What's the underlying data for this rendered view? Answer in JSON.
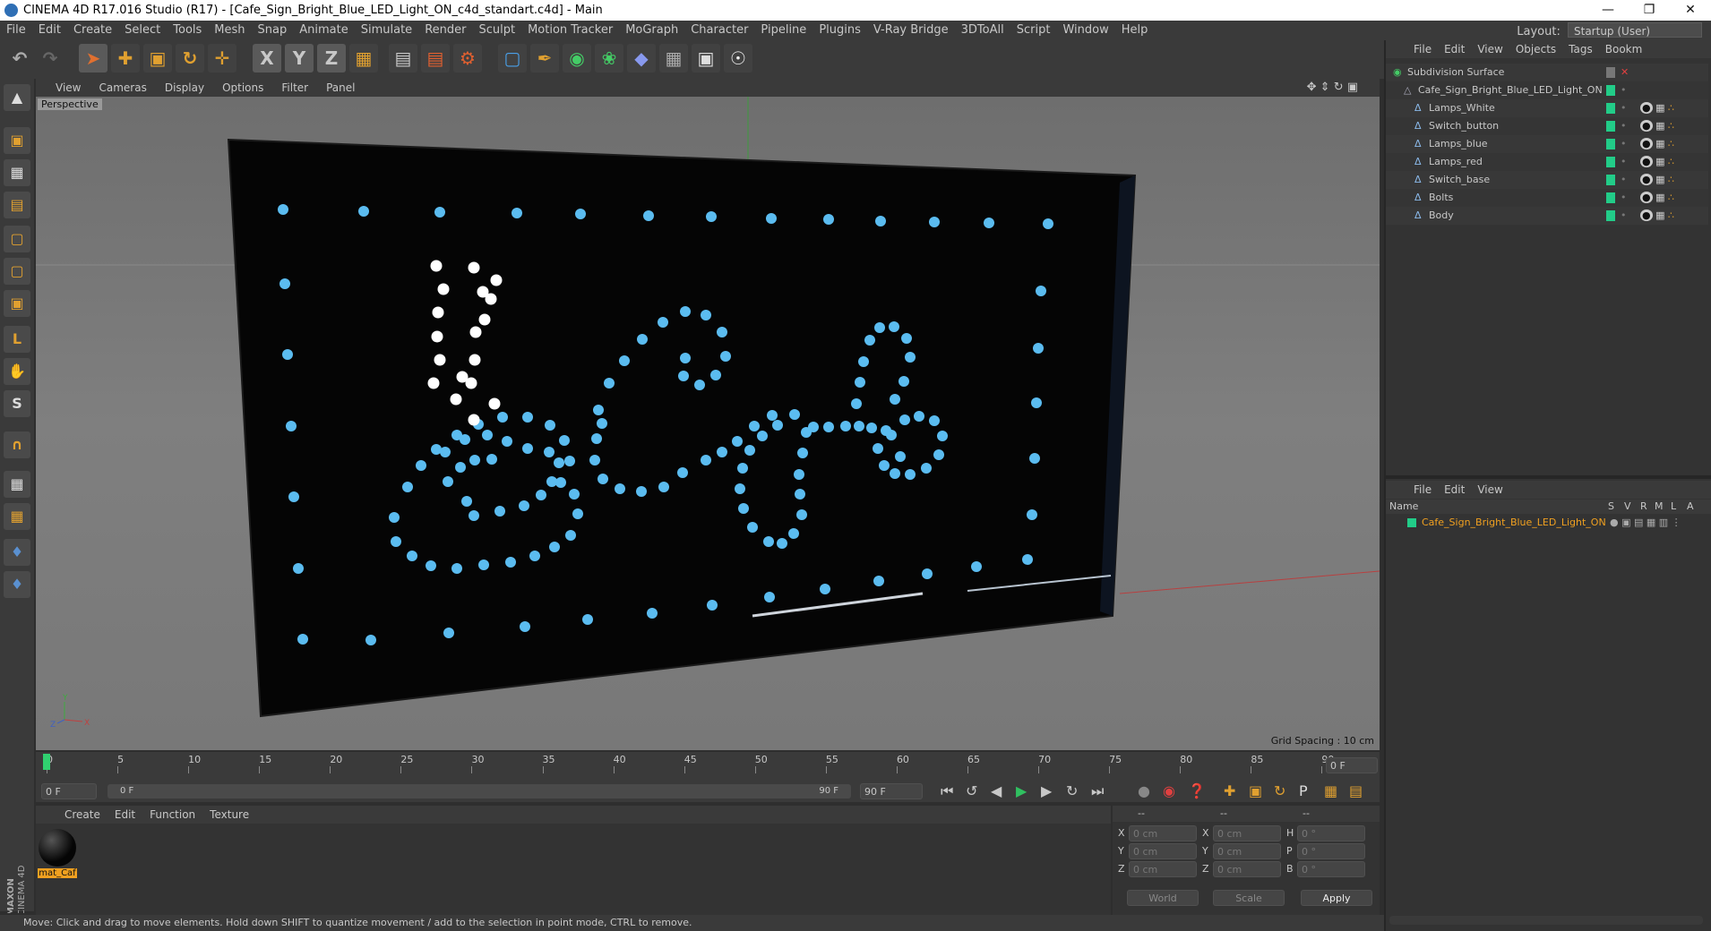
{
  "window": {
    "title": "CINEMA 4D R17.016 Studio (R17) - [Cafe_Sign_Bright_Blue_LED_Light_ON_c4d_standart.c4d] - Main"
  },
  "menubar": {
    "items": [
      "File",
      "Edit",
      "Create",
      "Select",
      "Tools",
      "Mesh",
      "Snap",
      "Animate",
      "Simulate",
      "Render",
      "Sculpt",
      "Motion Tracker",
      "MoGraph",
      "Character",
      "Pipeline",
      "Plugins",
      "V-Ray Bridge",
      "3DToAll",
      "Script",
      "Window",
      "Help"
    ],
    "layout_label": "Layout:",
    "layout_value": "Startup (User)"
  },
  "viewport": {
    "menu": [
      "View",
      "Cameras",
      "Display",
      "Options",
      "Filter",
      "Panel"
    ],
    "label": "Perspective",
    "grid_spacing": "Grid Spacing : 10 cm"
  },
  "timeline": {
    "ticks": [
      "0",
      "5",
      "10",
      "15",
      "20",
      "25",
      "30",
      "35",
      "40",
      "45",
      "50",
      "55",
      "60",
      "65",
      "70",
      "75",
      "80",
      "85",
      "90"
    ],
    "current_frame": "0 F",
    "start_field": "0 F",
    "range_start": "0 F",
    "range_end": "90 F",
    "end_field": "90 F"
  },
  "material_manager": {
    "menu": [
      "Create",
      "Edit",
      "Function",
      "Texture"
    ],
    "materials": [
      {
        "name": "mat_Caf"
      }
    ]
  },
  "coordinates": {
    "header": [
      "--",
      "--",
      "--"
    ],
    "rows": [
      {
        "a": "X",
        "av": "0 cm",
        "b": "X",
        "bv": "0 cm",
        "c": "H",
        "cv": "0 °"
      },
      {
        "a": "Y",
        "av": "0 cm",
        "b": "Y",
        "bv": "0 cm",
        "c": "P",
        "cv": "0 °"
      },
      {
        "a": "Z",
        "av": "0 cm",
        "b": "Z",
        "bv": "0 cm",
        "c": "B",
        "cv": "0 °"
      }
    ],
    "mode": "World",
    "scale": "Scale",
    "apply": "Apply"
  },
  "statusbar": {
    "text": "Move: Click and drag to move elements. Hold down SHIFT to quantize movement / add to the selection in point mode, CTRL to remove."
  },
  "object_manager": {
    "menu": [
      "File",
      "Edit",
      "View",
      "Objects",
      "Tags",
      "Bookm"
    ],
    "objects": [
      {
        "name": "Subdivision Surface",
        "level": 0
      },
      {
        "name": "Cafe_Sign_Bright_Blue_LED_Light_ON",
        "level": 1
      },
      {
        "name": "Lamps_White",
        "level": 2
      },
      {
        "name": "Switch_button",
        "level": 2
      },
      {
        "name": "Lamps_blue",
        "level": 2
      },
      {
        "name": "Lamps_red",
        "level": 2
      },
      {
        "name": "Switch_base",
        "level": 2
      },
      {
        "name": "Bolts",
        "level": 2
      },
      {
        "name": "Body",
        "level": 2
      }
    ]
  },
  "layer_manager": {
    "menu": [
      "File",
      "Edit",
      "View"
    ],
    "columns": {
      "name": "Name",
      "flags": [
        "S",
        "V",
        "R",
        "M",
        "L",
        "A"
      ]
    },
    "rows": [
      {
        "name": "Cafe_Sign_Bright_Blue_LED_Light_ON"
      }
    ]
  },
  "brand": {
    "line1": "MAXON",
    "line2": "CINEMA 4D"
  },
  "colors": {
    "led_blue": "#5bbcf0",
    "led_white": "#ffffff",
    "accent_orange": "#f0a020",
    "green": "#22cc88"
  }
}
